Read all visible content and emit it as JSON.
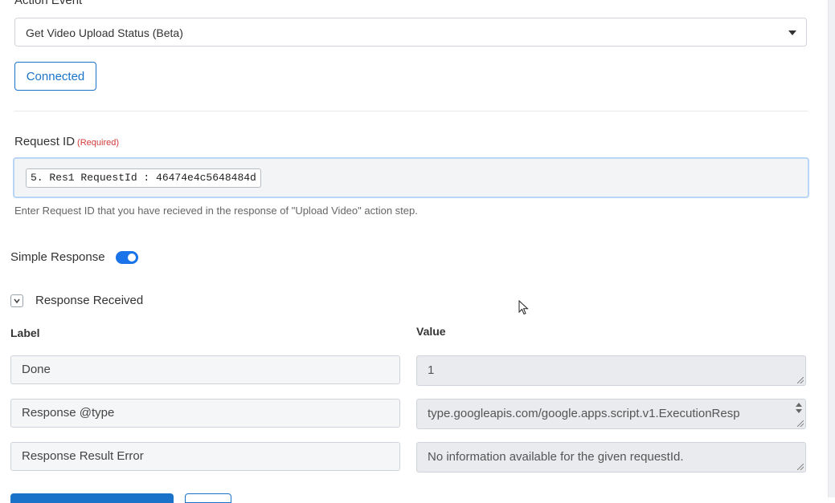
{
  "action_event": {
    "label": "Action Event",
    "selected": "Get Video Upload Status (Beta)"
  },
  "connected_button": "Connected",
  "request_id": {
    "label": "Request ID",
    "required": "(Required)",
    "chip": "5. Res1 RequestId : 46474e4c5648484d",
    "help": "Enter Request ID that you have recieved in the response of \"Upload Video\" action step."
  },
  "simple_response": {
    "label": "Simple Response",
    "enabled": true
  },
  "response_received": {
    "label": "Response Received",
    "icon": "chevron-down-icon"
  },
  "table": {
    "label_header": "Label",
    "value_header": "Value",
    "rows": [
      {
        "label": "Done",
        "value": "1"
      },
      {
        "label": "Response @type",
        "value": "type.googleapis.com/google.apps.script.v1.ExecutionResp"
      },
      {
        "label": "Response Result Error",
        "value": "No information available for the given requestId."
      }
    ]
  },
  "colors": {
    "accent": "#1a73c9",
    "required": "#d23b3b",
    "toggle": "#1a73e8"
  }
}
